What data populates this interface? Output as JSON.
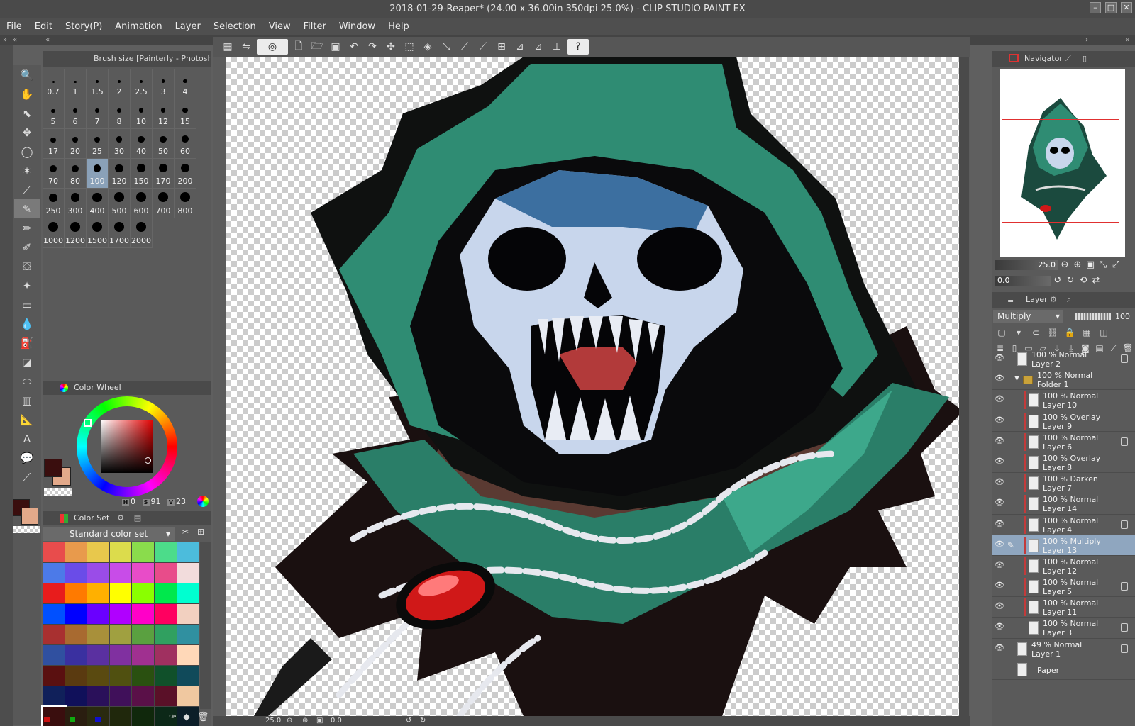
{
  "title": "2018-01-29-Reaper* (24.00 x 36.00in 350dpi 25.0%) - CLIP STUDIO PAINT EX",
  "menu": [
    "File",
    "Edit",
    "Story(P)",
    "Animation",
    "Layer",
    "Selection",
    "View",
    "Filter",
    "Window",
    "Help"
  ],
  "brush_panel": {
    "title": "Brush size [Painterly - Photoshop R...",
    "sizes": [
      "0.7",
      "1",
      "1.5",
      "2",
      "2.5",
      "3",
      "4",
      "5",
      "6",
      "7",
      "8",
      "10",
      "12",
      "15",
      "17",
      "20",
      "25",
      "30",
      "40",
      "50",
      "60",
      "70",
      "80",
      "100",
      "120",
      "150",
      "170",
      "200",
      "250",
      "300",
      "400",
      "500",
      "600",
      "700",
      "800",
      "1000",
      "1200",
      "1500",
      "1700",
      "2000"
    ],
    "selected": "100"
  },
  "color_wheel": {
    "title": "Color Wheel",
    "h_label": "H",
    "h": "0",
    "s_label": "S",
    "s": "91",
    "v_label": "V",
    "v": "23",
    "main_color": "#3a0e0e",
    "sub_color": "#e3a98a"
  },
  "color_set": {
    "title": "Color Set",
    "selected_set": "Standard color set",
    "swatches": [
      "#e84c4c",
      "#e89a4c",
      "#e8c84c",
      "#dcdc4c",
      "#8adc4c",
      "#4cdc8a",
      "#4cbcdc",
      "#4c7ae8",
      "#6a4ce8",
      "#9a4ce8",
      "#c84ce8",
      "#e84cc8",
      "#e84c8a",
      "#f2dcdc",
      "#e81c1c",
      "#ff7a00",
      "#ffb000",
      "#ffff00",
      "#8aff00",
      "#00e84c",
      "#00ffd0",
      "#0050ff",
      "#0000ff",
      "#6a00ff",
      "#b000ff",
      "#ff00c8",
      "#ff0060",
      "#f2d0c0",
      "#a83030",
      "#a86a30",
      "#a8903a",
      "#a0a040",
      "#5aa040",
      "#30a060",
      "#3090a0",
      "#3050a0",
      "#3a30a0",
      "#5a30a0",
      "#8030a0",
      "#a03090",
      "#a03060",
      "#ffd8b8",
      "#5a1010",
      "#5a3a10",
      "#5a4a10",
      "#505010",
      "#2a5010",
      "#10502a",
      "#104a5a",
      "#10205a",
      "#10105a",
      "#2a105a",
      "#40105a",
      "#5a1048",
      "#5a1028",
      "#f0c8a0",
      "#3a0e0e",
      "#2a1e10",
      "#2a2a10",
      "#20280c",
      "#10280c",
      "#0c2818",
      "#0c1e28"
    ],
    "tiny_colors": [
      "#cc1010",
      "#10aa10",
      "#1010cc"
    ]
  },
  "navigator": {
    "title": "Navigator",
    "zoom": "25.0",
    "rotation": "0.0"
  },
  "layer_panel": {
    "title": "Layer",
    "blend_mode": "Multiply",
    "opacity": "100",
    "layers": [
      {
        "mode": "100 % Normal",
        "name": "Layer 2",
        "indent": 0,
        "clip": false,
        "lock": true,
        "selected": false,
        "folder": false
      },
      {
        "mode": "100 % Normal",
        "name": "Folder 1",
        "indent": 1,
        "clip": false,
        "lock": false,
        "selected": false,
        "folder": true
      },
      {
        "mode": "100 % Normal",
        "name": "Layer 10",
        "indent": 2,
        "clip": true,
        "lock": false,
        "selected": false,
        "folder": false
      },
      {
        "mode": "100 % Overlay",
        "name": "Layer 9",
        "indent": 2,
        "clip": true,
        "lock": false,
        "selected": false,
        "folder": false
      },
      {
        "mode": "100 % Normal",
        "name": "Layer 6",
        "indent": 2,
        "clip": true,
        "lock": true,
        "selected": false,
        "folder": false
      },
      {
        "mode": "100 % Overlay",
        "name": "Layer 8",
        "indent": 2,
        "clip": true,
        "lock": false,
        "selected": false,
        "folder": false
      },
      {
        "mode": "100 % Darken",
        "name": "Layer 7",
        "indent": 2,
        "clip": true,
        "lock": false,
        "selected": false,
        "folder": false
      },
      {
        "mode": "100 % Normal",
        "name": "Layer 14",
        "indent": 2,
        "clip": true,
        "lock": false,
        "selected": false,
        "folder": false
      },
      {
        "mode": "100 % Normal",
        "name": "Layer 4",
        "indent": 2,
        "clip": true,
        "lock": true,
        "selected": false,
        "folder": false
      },
      {
        "mode": "100 % Multiply",
        "name": "Layer 13",
        "indent": 2,
        "clip": true,
        "lock": false,
        "selected": true,
        "folder": false
      },
      {
        "mode": "100 % Normal",
        "name": "Layer 12",
        "indent": 2,
        "clip": true,
        "lock": false,
        "selected": false,
        "folder": false
      },
      {
        "mode": "100 % Normal",
        "name": "Layer 5",
        "indent": 2,
        "clip": true,
        "lock": true,
        "selected": false,
        "folder": false
      },
      {
        "mode": "100 % Normal",
        "name": "Layer 11",
        "indent": 2,
        "clip": true,
        "lock": false,
        "selected": false,
        "folder": false
      },
      {
        "mode": "100 % Normal",
        "name": "Layer 3",
        "indent": 2,
        "clip": false,
        "lock": true,
        "selected": false,
        "folder": false
      },
      {
        "mode": "49 % Normal",
        "name": "Layer 1",
        "indent": 0,
        "clip": false,
        "lock": true,
        "selected": false,
        "folder": false
      },
      {
        "mode": "",
        "name": "Paper",
        "indent": 0,
        "clip": false,
        "lock": false,
        "selected": false,
        "folder": false
      }
    ]
  },
  "status": {
    "zoom": "25.0",
    "angle": "0.0"
  }
}
